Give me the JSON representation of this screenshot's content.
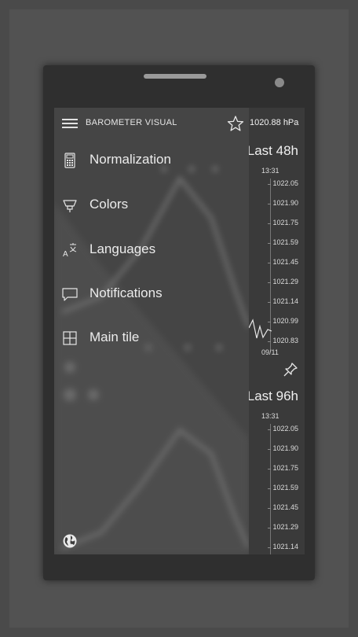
{
  "app": {
    "title": "BAROMETER VISUAL",
    "current_pressure": "1020.88 hPa"
  },
  "icons": {
    "menu": "hamburger-icon",
    "favorite": "star-icon",
    "pin": "pin-icon",
    "globe": "globe-icon"
  },
  "menu": {
    "items": [
      {
        "label": "Normalization",
        "icon": "calculator-icon"
      },
      {
        "label": "Colors",
        "icon": "paint-bucket-icon"
      },
      {
        "label": "Languages",
        "icon": "translate-icon"
      },
      {
        "label": "Notifications",
        "icon": "chat-bubble-icon"
      },
      {
        "label": "Main tile",
        "icon": "tile-grid-icon"
      }
    ]
  },
  "charts": [
    {
      "title": "Last 48h",
      "time_label": "13:31",
      "date_label": "09/11",
      "y_ticks": [
        "1022.05",
        "1021.90",
        "1021.75",
        "1021.59",
        "1021.45",
        "1021.29",
        "1021.14",
        "1020.99",
        "1020.83"
      ]
    },
    {
      "title": "Last 96h",
      "time_label": "13:31",
      "y_ticks": [
        "1022.05",
        "1021.90",
        "1021.75",
        "1021.59",
        "1021.45",
        "1021.29",
        "1021.14"
      ]
    }
  ],
  "colors": {
    "background": "#4a4a4a",
    "phone": "#2f2f2f",
    "screen": "#3c3c3c",
    "text": "#e6e6e6"
  }
}
